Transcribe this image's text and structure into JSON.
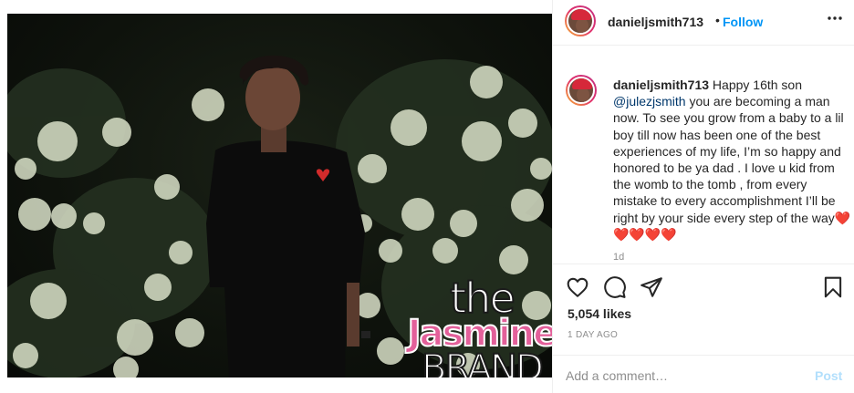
{
  "post": {
    "username": "danieljsmith713",
    "separator": "•",
    "follow_label": "Follow",
    "more_icon": "more-horizontal-icon",
    "caption": {
      "username": "danieljsmith713",
      "text_before_mention": " Happy 16th son ",
      "mention": "@julezjsmith",
      "text_after_mention": " you are becoming a man now. To see you grow from a baby to a lil boy till now has been one of the best experiences of my life, I’m so happy and honored to be ya dad . I love u kid from the womb to the tomb , from every mistake to every accomplishment I’ll be right by your side every step of the way",
      "emojis": "❤️❤️❤️❤️❤️",
      "relative_time": "1d"
    },
    "actions": {
      "like_icon": "heart-icon",
      "comment_icon": "comment-icon",
      "share_icon": "send-icon",
      "save_icon": "bookmark-icon"
    },
    "likes_text": "5,054 likes",
    "posted_ago": "1 DAY AGO",
    "comment": {
      "placeholder": "Add a comment…",
      "post_label": "Post"
    }
  },
  "watermark": {
    "line1": "the",
    "line2": "Jasmine",
    "line3": "BRAND"
  },
  "colors": {
    "link_blue": "#0095f6",
    "post_disabled": "#b2dffc",
    "watermark_pink": "#e3609a",
    "heart_red": "#e0245e"
  }
}
